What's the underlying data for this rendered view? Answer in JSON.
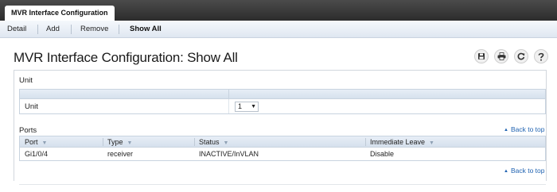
{
  "app": {
    "main_tab": "MVR Interface Configuration"
  },
  "subnav": {
    "items": [
      {
        "label": "Detail",
        "active": false
      },
      {
        "label": "Add",
        "active": false
      },
      {
        "label": "Remove",
        "active": false
      },
      {
        "label": "Show All",
        "active": true
      }
    ]
  },
  "page": {
    "title": "MVR Interface Configuration: Show All"
  },
  "toolbar": {
    "icons": [
      "save-icon",
      "print-icon",
      "refresh-icon",
      "help-icon"
    ]
  },
  "unit_section": {
    "heading": "Unit",
    "field_label": "Unit",
    "selected_value": "1"
  },
  "ports_section": {
    "heading": "Ports",
    "back_to_top": "Back to top",
    "columns": [
      "Port",
      "Type",
      "Status",
      "Immediate Leave"
    ],
    "rows": [
      [
        "Gi1/0/4",
        "receiver",
        "INACTIVE/InVLAN",
        "Disable"
      ]
    ]
  },
  "footer": {
    "back_to_top": "Back to top"
  }
}
